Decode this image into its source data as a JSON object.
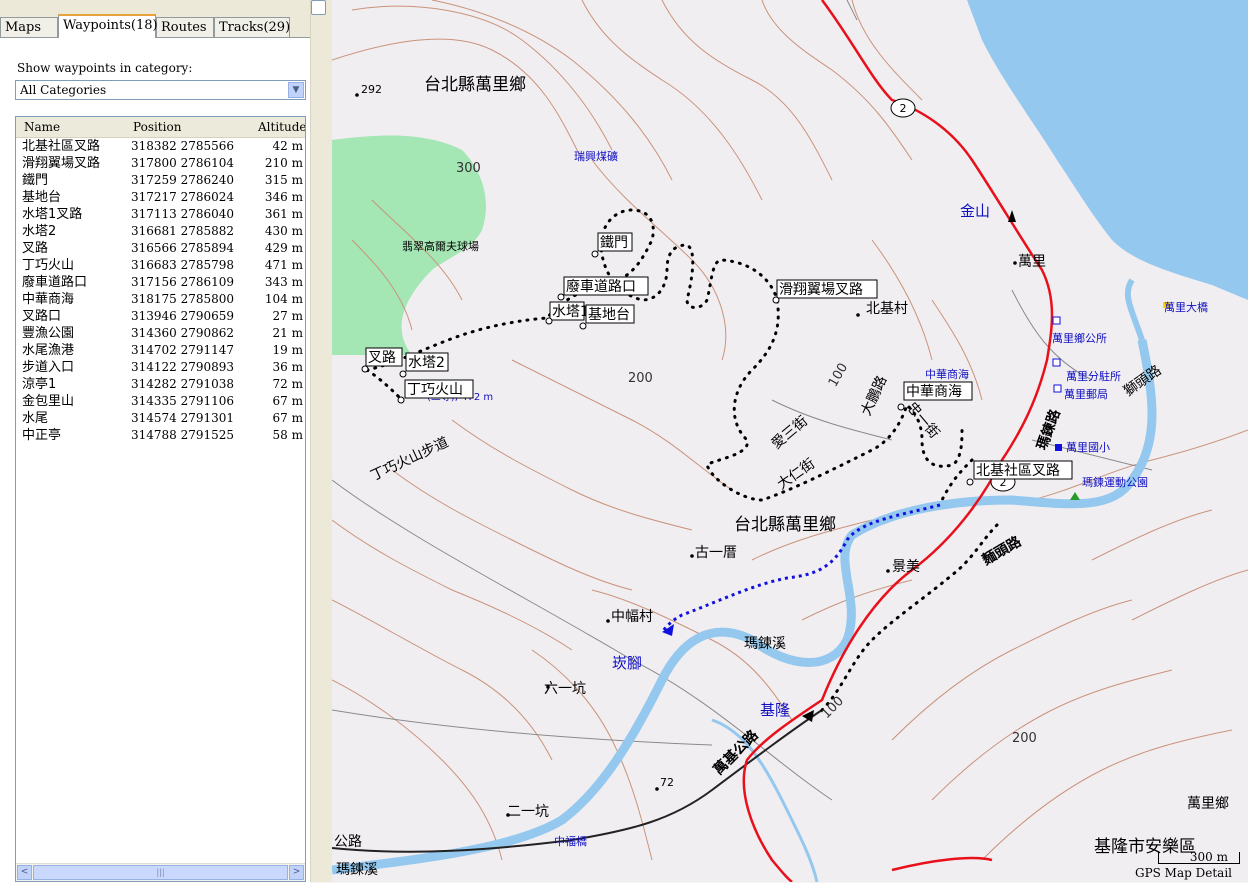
{
  "tabs": [
    {
      "label": "Maps",
      "active": false
    },
    {
      "label": "Waypoints(18)",
      "active": true
    },
    {
      "label": "Routes",
      "active": false
    },
    {
      "label": "Tracks(29)",
      "active": false
    }
  ],
  "category": {
    "label": "Show waypoints in category:",
    "selected": "All Categories"
  },
  "table": {
    "columns": [
      "Name",
      "Position",
      "Altitude"
    ],
    "rows": [
      {
        "name": "北基社區叉路",
        "position": "318382 2785566",
        "altitude": "42 m"
      },
      {
        "name": "滑翔翼場叉路",
        "position": "317800 2786104",
        "altitude": "210 m"
      },
      {
        "name": "鐵門",
        "position": "317259 2786240",
        "altitude": "315 m"
      },
      {
        "name": "基地台",
        "position": "317217 2786024",
        "altitude": "346 m"
      },
      {
        "name": "水塔1叉路",
        "position": "317113 2786040",
        "altitude": "361 m"
      },
      {
        "name": "水塔2",
        "position": "316681 2785882",
        "altitude": "430 m"
      },
      {
        "name": "叉路",
        "position": "316566 2785894",
        "altitude": "429 m"
      },
      {
        "name": "丁巧火山",
        "position": "316683 2785798",
        "altitude": "471 m"
      },
      {
        "name": "廢車道路口",
        "position": "317156 2786109",
        "altitude": "343 m"
      },
      {
        "name": "中華商海",
        "position": "318175 2785800",
        "altitude": "104 m"
      },
      {
        "name": "叉路口",
        "position": "313946 2790659",
        "altitude": "27 m"
      },
      {
        "name": "豐漁公園",
        "position": "314360 2790862",
        "altitude": "21 m"
      },
      {
        "name": "水尾漁港",
        "position": "314702 2791147",
        "altitude": "19 m"
      },
      {
        "name": "步道入口",
        "position": "314122 2790893",
        "altitude": "36 m"
      },
      {
        "name": "涼亭1",
        "position": "314282 2791038",
        "altitude": "72 m"
      },
      {
        "name": "金包里山",
        "position": "314335 2791106",
        "altitude": "67 m"
      },
      {
        "name": "水尾",
        "position": "314574 2791301",
        "altitude": "67 m"
      },
      {
        "name": "中正亭",
        "position": "314788 2791525",
        "altitude": "58 m"
      }
    ]
  },
  "scrollbar": {
    "left": "<",
    "right": ">",
    "thumb": "|||"
  },
  "map": {
    "scale_label": "300 m",
    "caption": "GPS Map Detail",
    "labels": {
      "wanli1": "台北縣萬里鄉",
      "wanli2": "台北縣萬里鄉",
      "wanli3": "萬里鄉",
      "anle": "基隆市安樂區",
      "h292": "292",
      "c300": "300",
      "c200a": "200",
      "c200b": "200",
      "c100a": "100",
      "c100b": "100",
      "h72": "72",
      "golf": "翡翠高爾夫球場",
      "mine": "瑞興煤礦",
      "jinshan": "金山",
      "wanli": "萬里",
      "bridge": "萬里大橋",
      "office": "萬里鄉公所",
      "police": "萬里分駐所",
      "post": "萬里郵局",
      "school": "萬里國小",
      "park": "瑪鍊運動公園",
      "beiji": "北基村",
      "zhsh": "中華商海",
      "gu": "古一厝",
      "jm": "景美",
      "zf": "中幅村",
      "mlx": "瑪鍊溪",
      "kl1": "崁腳",
      "kl2": "基隆",
      "lyk": "六一坑",
      "eyk": "二一坑",
      "zfq": "中福橋",
      "mlx2": "瑪鍊溪",
      "road": "公路",
      "mdl": "瑪鍊路",
      "mtl": "獅頭路",
      "mtl2": "麵頭路",
      "wkl": "萬基公路",
      "dal": "大鵬路",
      "asj": "愛三街",
      "arj": "大仁街",
      "zyj": "忠一街",
      "trail": "丁巧火山步道",
      "summit": "(三等), 472 m",
      "r2a": "2",
      "r2b": "2",
      "wp_tiemen": "鐵門",
      "wp_feiche": "廢車道路口",
      "wp_shuita1": "水塔1",
      "wp_jidi": "基地台",
      "wp_huaxiang": "滑翔翼場叉路",
      "wp_zhonghua": "中華商海",
      "wp_beiji": "北基社區叉路",
      "wp_chalu": "叉路",
      "wp_shuita2": "水塔2",
      "wp_dingqiao": "丁巧火山"
    }
  },
  "colors": {
    "water": "#94c8ee",
    "road": "#e8101a",
    "contour": "#c9937a",
    "golf": "#a4e6b4",
    "route": "#1010e0"
  }
}
